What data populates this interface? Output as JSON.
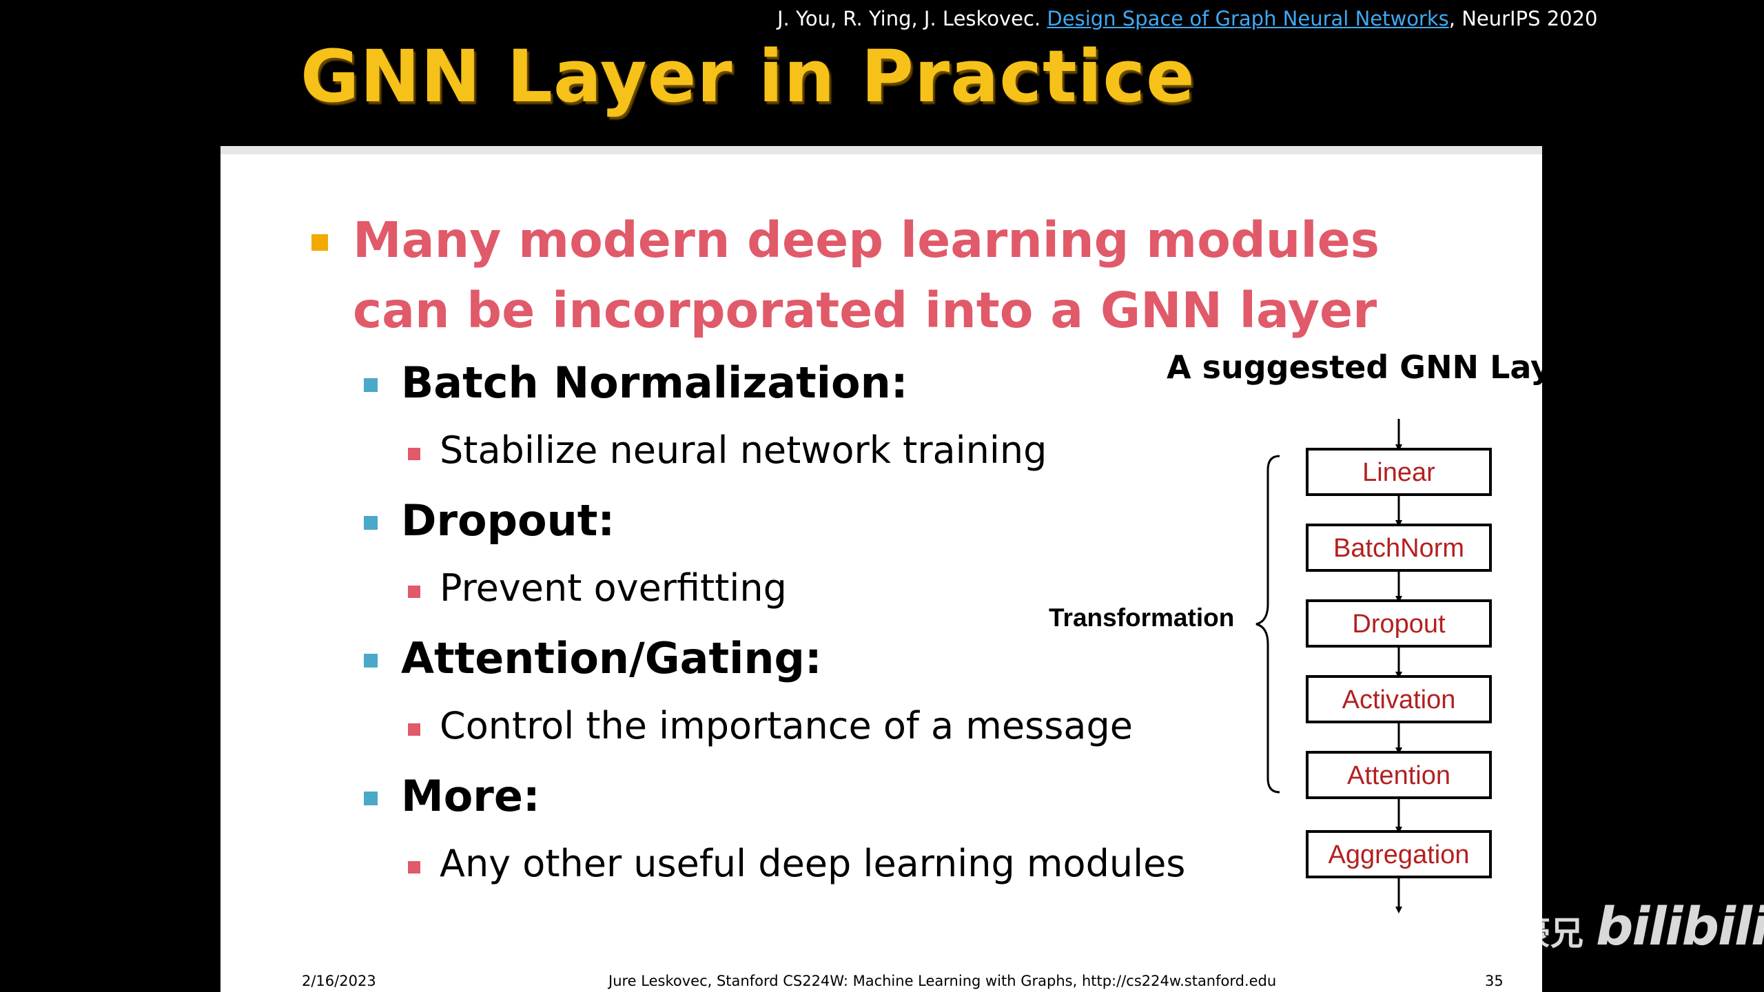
{
  "citation": {
    "authors": "J. You, R. Ying, J. Leskovec. ",
    "link_text": "Design Space of Graph Neural Networks",
    "venue": ", NeurIPS 2020"
  },
  "title": "GNN Layer in Practice",
  "main_bullet": "Many modern deep learning modules can be incorporated into a GNN layer",
  "items": [
    {
      "heading": "Batch Normalization:",
      "detail": "Stabilize neural network training"
    },
    {
      "heading": "Dropout:",
      "detail": "Prevent overfitting"
    },
    {
      "heading": "Attention/Gating:",
      "detail": "Control the importance of a message"
    },
    {
      "heading": "More:",
      "detail": "Any other useful deep learning modules"
    }
  ],
  "diagram": {
    "title": "A suggested GNN Layer",
    "group_label": "Transformation",
    "boxes": [
      "Linear",
      "BatchNorm",
      "Dropout",
      "Activation",
      "Attention",
      "Aggregation"
    ]
  },
  "footer": {
    "date": "2/16/2023",
    "credit": "Jure Leskovec, Stanford CS224W: Machine Learning with Graphs, http://cs224w.stanford.edu",
    "page": "35"
  },
  "watermark": {
    "text": "同济子豪兄",
    "brand": "bilibili"
  },
  "colors": {
    "title": "#f6c21a",
    "main_bullet": "#e05a6a",
    "box_label": "#b32020",
    "link": "#3fa9f5"
  }
}
